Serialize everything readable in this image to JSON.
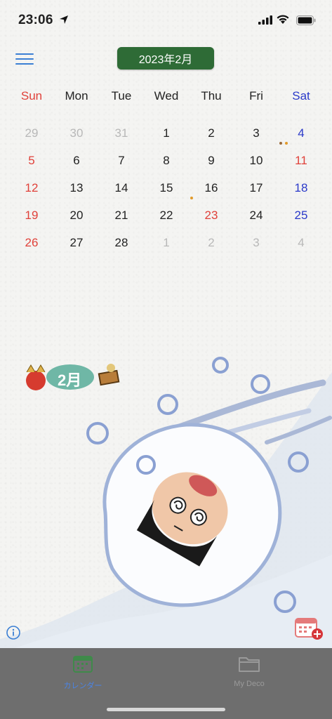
{
  "status": {
    "time": "23:06"
  },
  "header": {
    "month_title": "2023年2月"
  },
  "calendar": {
    "weekdays": [
      "Sun",
      "Mon",
      "Tue",
      "Wed",
      "Thu",
      "Fri",
      "Sat"
    ],
    "weeks": [
      [
        "29",
        "30",
        "31",
        "1",
        "2",
        "3",
        "4"
      ],
      [
        "5",
        "6",
        "7",
        "8",
        "9",
        "10",
        "11"
      ],
      [
        "12",
        "13",
        "14",
        "15",
        "16",
        "17",
        "18"
      ],
      [
        "19",
        "20",
        "21",
        "22",
        "23",
        "24",
        "25"
      ],
      [
        "26",
        "27",
        "28",
        "1",
        "2",
        "3",
        "4"
      ]
    ]
  },
  "decoration": {
    "month_badge": "2月"
  },
  "tabs": [
    {
      "label": "カレンダー",
      "active": true
    },
    {
      "label": "My Deco",
      "active": false
    }
  ],
  "colors": {
    "accent": "#2e6b36",
    "sunday": "#e0413a",
    "saturday": "#2a39c9",
    "tab_active": "#4a84e6",
    "tabbar": "#6e6e6e"
  },
  "icons": [
    "location-arrow-icon",
    "signal-icon",
    "wifi-icon",
    "battery-icon",
    "menu-icon",
    "info-icon",
    "add-calendar-icon",
    "calendar-tab-icon",
    "folder-tab-icon"
  ]
}
